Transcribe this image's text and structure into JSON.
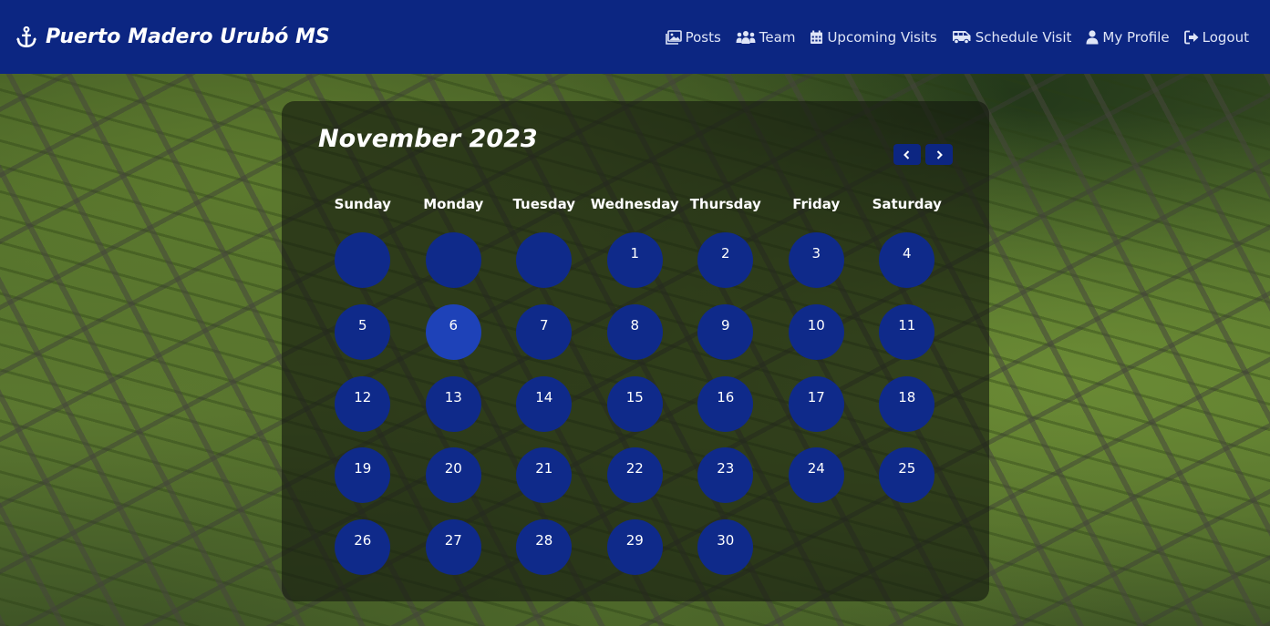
{
  "navbar": {
    "brand": "Puerto Madero Urubó MS",
    "brand_icon": "anchor-icon",
    "links": [
      {
        "label": "Posts",
        "icon": "images-icon"
      },
      {
        "label": "Team",
        "icon": "users-icon"
      },
      {
        "label": "Upcoming Visits",
        "icon": "calendar-icon"
      },
      {
        "label": "Schedule Visit",
        "icon": "bus-icon"
      },
      {
        "label": "My Profile",
        "icon": "user-icon"
      },
      {
        "label": "Logout",
        "icon": "logout-icon"
      }
    ]
  },
  "calendar": {
    "title": "November 2023",
    "prev_icon": "chevron-left-icon",
    "next_icon": "chevron-right-icon",
    "weekdays": [
      "Sunday",
      "Monday",
      "Tuesday",
      "Wednesday",
      "Thursday",
      "Friday",
      "Saturday"
    ],
    "leading_empty_days": 3,
    "days": [
      "1",
      "2",
      "3",
      "4",
      "5",
      "6",
      "7",
      "8",
      "9",
      "10",
      "11",
      "12",
      "13",
      "14",
      "15",
      "16",
      "17",
      "18",
      "19",
      "20",
      "21",
      "22",
      "23",
      "24",
      "25",
      "26",
      "27",
      "28",
      "29",
      "30"
    ],
    "selected_day": "6"
  },
  "colors": {
    "navbar": "#0c2682",
    "day_circle": "#0f2a8a",
    "selected_day": "#1e42b8",
    "text": "#ffffff"
  }
}
